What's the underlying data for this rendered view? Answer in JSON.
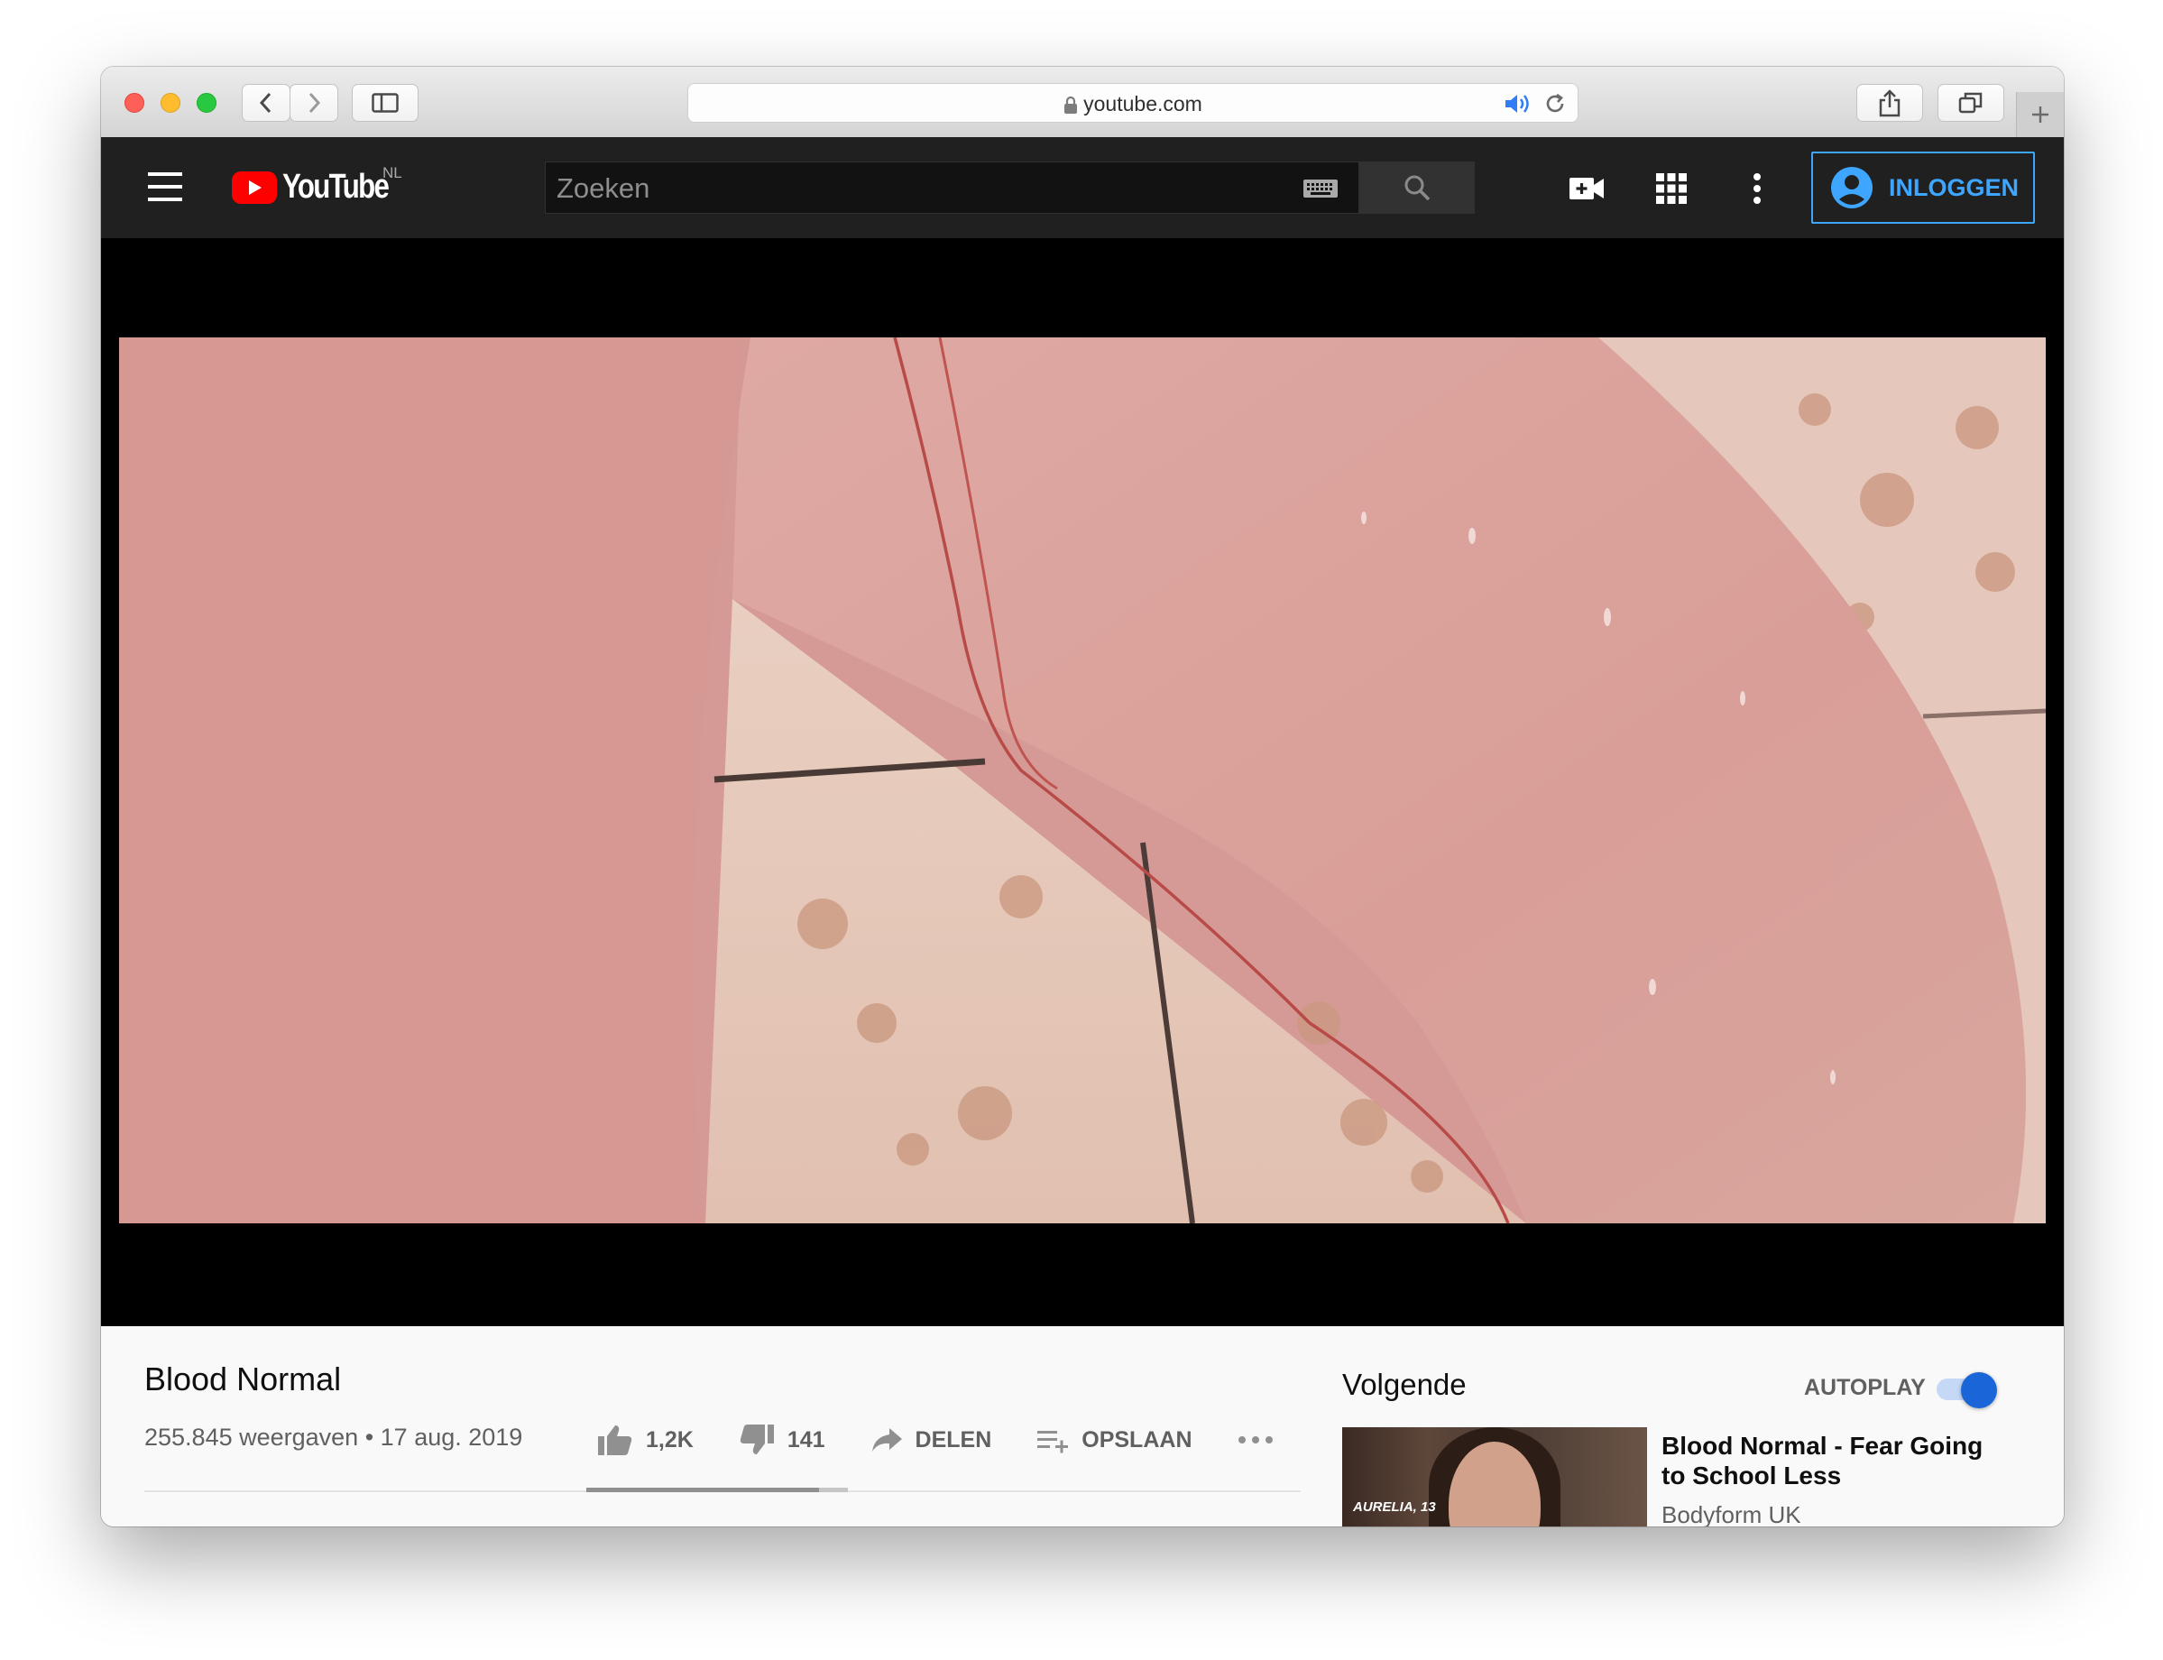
{
  "browser": {
    "url": "youtube.com"
  },
  "masthead": {
    "logo_text": "YouTube",
    "region": "NL",
    "search_placeholder": "Zoeken",
    "signin_label": "INLOGGEN"
  },
  "video": {
    "title": "Blood Normal",
    "views": "255.845 weergaven",
    "date": "17 aug. 2019",
    "likes": "1,2K",
    "dislikes": "141",
    "share_label": "DELEN",
    "save_label": "OPSLAAN",
    "like_ratio": 0.89
  },
  "sidebar": {
    "next_label": "Volgende",
    "autoplay_label": "AUTOPLAY",
    "autoplay_on": true,
    "recommendation": {
      "title": "Blood Normal - Fear Going to School Less",
      "channel": "Bodyform UK",
      "thumbnail_caption": "AURELIA, 13"
    }
  },
  "colors": {
    "brand_red": "#ff0000",
    "accent_blue": "#3ea6ff",
    "toggle_blue": "#1a66d8"
  }
}
